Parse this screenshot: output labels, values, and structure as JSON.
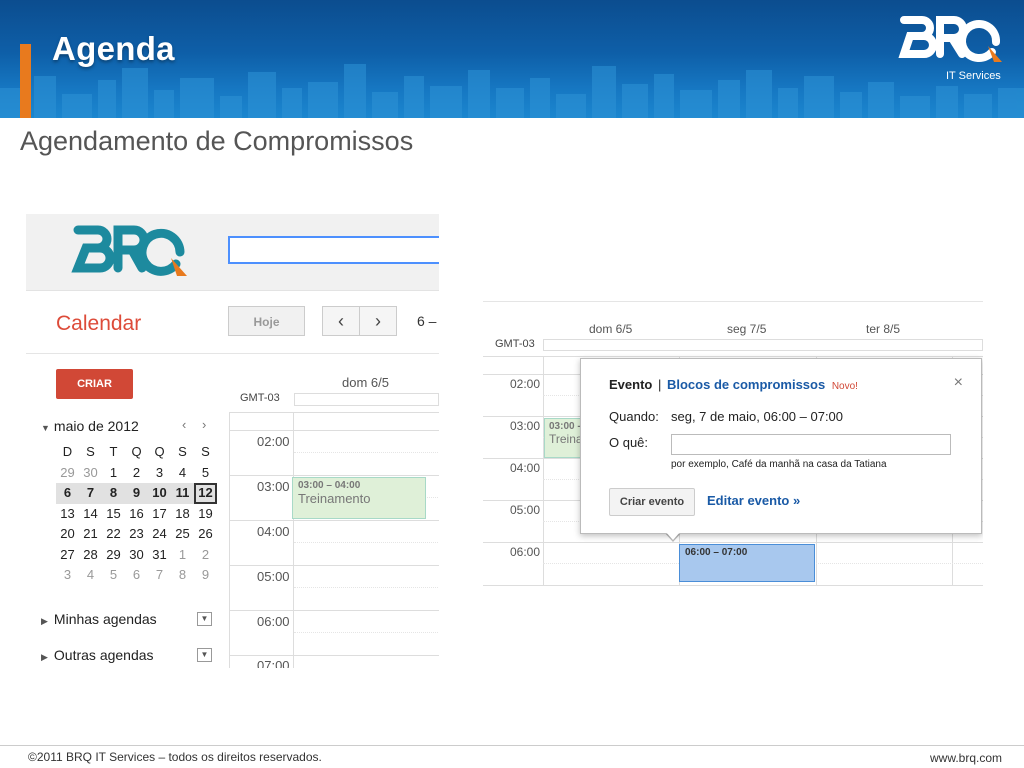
{
  "slide": {
    "title": "Agenda",
    "subtitle": "Agendamento de Compromissos",
    "brand_tagline": "IT Services",
    "footer_copyright": "©2011 BRQ IT Services – todos os direitos reservados.",
    "footer_site": "www.brq.com",
    "brand_logo_text": "BRQ"
  },
  "left_screenshot": {
    "calendar_label": "Calendar",
    "today_button": "Hoje",
    "prev_icon": "chevron-left-icon",
    "next_icon": "chevron-right-icon",
    "date_range": "6 –",
    "create_button": "CRIAR",
    "mini_month": "maio de 2012",
    "mini_nav_prev": "‹",
    "mini_nav_next": "›",
    "weekday_heads": [
      "D",
      "S",
      "T",
      "Q",
      "Q",
      "S",
      "S"
    ],
    "weeks": [
      [
        "29",
        "30",
        "1",
        "2",
        "3",
        "4",
        "5"
      ],
      [
        "6",
        "7",
        "8",
        "9",
        "10",
        "11",
        "12"
      ],
      [
        "13",
        "14",
        "15",
        "16",
        "17",
        "18",
        "19"
      ],
      [
        "20",
        "21",
        "22",
        "23",
        "24",
        "25",
        "26"
      ],
      [
        "27",
        "28",
        "29",
        "30",
        "31",
        "1",
        "2"
      ],
      [
        "3",
        "4",
        "5",
        "6",
        "7",
        "8",
        "9"
      ]
    ],
    "my_calendars": "Minhas agendas",
    "other_calendars": "Outras agendas",
    "day_header": "dom 6/5",
    "timezone": "GMT-03",
    "time_labels": [
      "02:00",
      "03:00",
      "04:00",
      "05:00",
      "06:00",
      "07:00"
    ],
    "event": {
      "time": "03:00 – 04:00",
      "name": "Treinamento"
    }
  },
  "right_screenshot": {
    "day_headers": [
      "dom 6/5",
      "seg 7/5",
      "ter 8/5"
    ],
    "timezone": "GMT-03",
    "time_labels": [
      "02:00",
      "03:00",
      "04:00",
      "05:00",
      "06:00"
    ],
    "event_partial": {
      "time": "03:00 -",
      "name": "Treina"
    },
    "new_event_time": "06:00 – 07:00",
    "popup": {
      "tab_event": "Evento",
      "separator": "|",
      "tab_blocks": "Blocos de compromissos",
      "new_badge": "Novo!",
      "close": "×",
      "when_label": "Quando:",
      "when_value": "seg, 7 de maio, 06:00 – 07:00",
      "what_label": "O quê:",
      "what_value": "",
      "hint": "por exemplo, Café da manhã na casa da Tatiana",
      "create_button": "Criar evento",
      "edit_link": "Editar evento »"
    }
  },
  "colors": {
    "banner_blue": "#0e5fa8",
    "accent_orange": "#e87a1e",
    "brq_teal": "#1d8a9e",
    "create_red": "#d14836",
    "event_green": "#dff0d8",
    "event_blue": "#a8c8ee",
    "link_blue": "#1a5aa6"
  }
}
